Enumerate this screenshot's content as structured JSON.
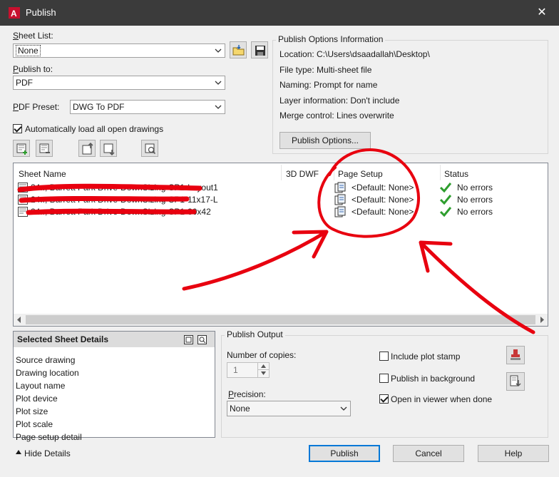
{
  "window": {
    "title": "Publish",
    "close_glyph": "✕"
  },
  "sheet_list": {
    "label": "Sheet List:",
    "value": "None"
  },
  "publish_to": {
    "label": "Publish to:",
    "value": "PDF"
  },
  "pdf_preset": {
    "label": "PDF Preset:",
    "value": "DWG To PDF"
  },
  "auto_load": {
    "label": "Automatically load all open drawings",
    "checked": true
  },
  "options_info": {
    "title": "Publish Options Information",
    "location": "Location: C:\\Users\\dsaadallah\\Desktop\\",
    "file_type": "File type: Multi-sheet file",
    "naming": "Naming: Prompt for name",
    "layer_info": "Layer information: Don't include",
    "merge_control": "Merge control: Lines overwrite",
    "button_label": "Publish Options..."
  },
  "table": {
    "columns": [
      "Sheet Name",
      "3D DWF",
      "Page Setup",
      "Status"
    ],
    "rows": [
      {
        "name": "24.., Barrett Park Drive-DownSizing-SP1-Layout1",
        "page_setup": "<Default: None>",
        "status": "No errors"
      },
      {
        "name": "24.., Barrett Park Drive-DownSizing-SP1-11x17-L",
        "page_setup": "<Default: None>",
        "status": "No errors"
      },
      {
        "name": "24.., Barrett Park Drive-DownSizing-SP1-30x42",
        "page_setup": "<Default: None>",
        "status": "No errors"
      }
    ]
  },
  "selected_details": {
    "title": "Selected Sheet Details",
    "items": [
      "Source drawing",
      "Drawing location",
      "Layout name",
      "Plot device",
      "Plot size",
      "Plot scale",
      "Page setup detail"
    ]
  },
  "publish_output": {
    "title": "Publish Output",
    "copies_label": "Number of copies:",
    "copies_value": "1",
    "precision_label": "Precision:",
    "precision_value": "None",
    "include_plot_stamp": "Include plot stamp",
    "publish_background": "Publish in background",
    "open_viewer": "Open in viewer when done"
  },
  "footer": {
    "hide_details": "Hide Details",
    "publish": "Publish",
    "cancel": "Cancel",
    "help": "Help"
  },
  "colors": {
    "accent": "#0078d7",
    "annotation": "#e8000f",
    "status_ok": "#2e9e2e"
  }
}
